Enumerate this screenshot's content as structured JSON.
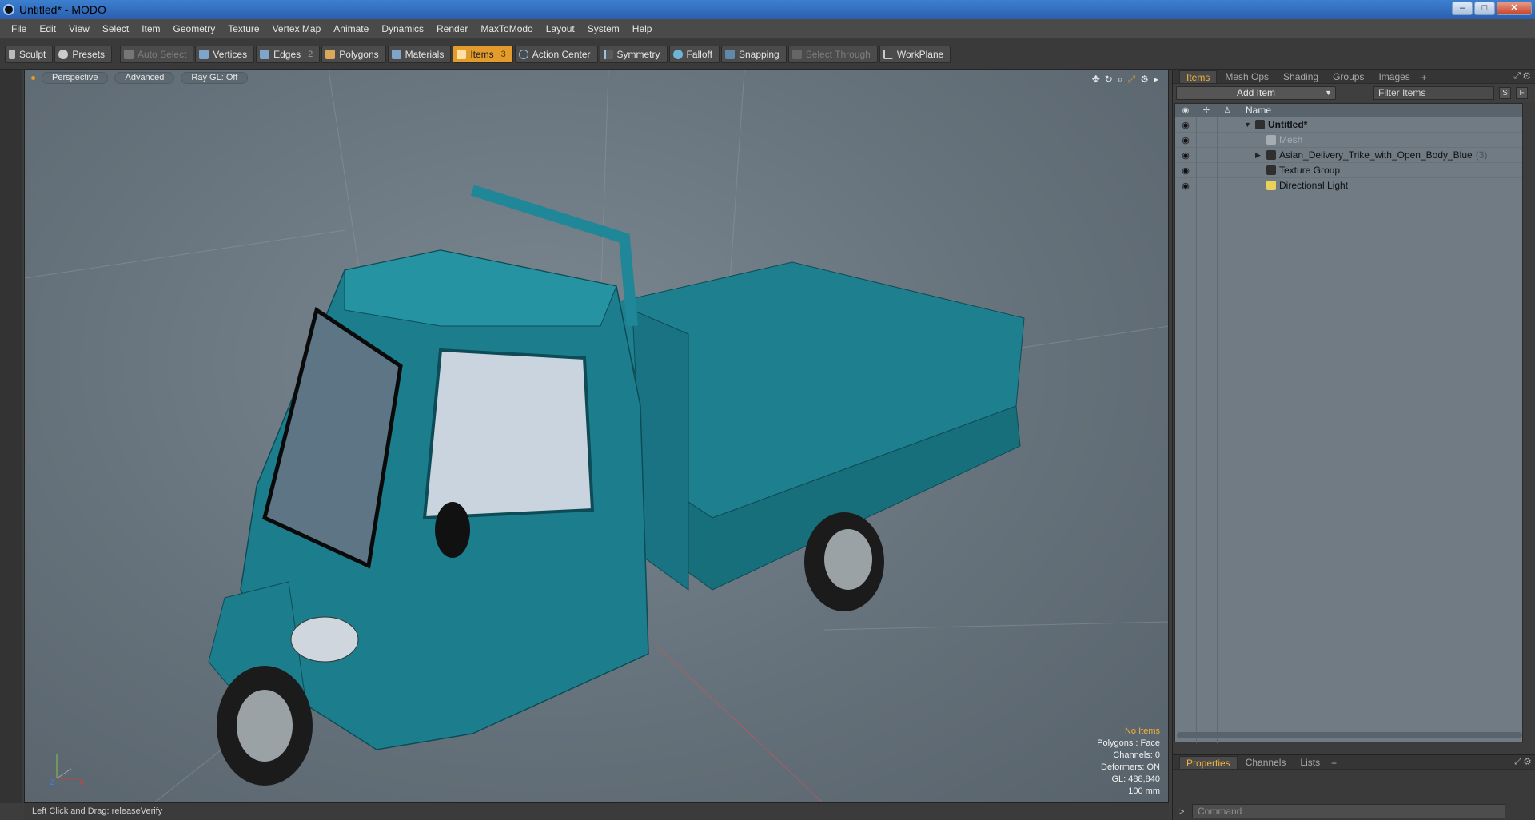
{
  "window": {
    "title": "Untitled* - MODO",
    "min": "–",
    "max": "□",
    "close": "✕"
  },
  "menu": [
    "File",
    "Edit",
    "View",
    "Select",
    "Item",
    "Geometry",
    "Texture",
    "Vertex Map",
    "Animate",
    "Dynamics",
    "Render",
    "MaxToModo",
    "Layout",
    "System",
    "Help"
  ],
  "toolbar": {
    "sculpt": "Sculpt",
    "presets": "Presets",
    "auto_select": "Auto Select",
    "vertices": "Vertices",
    "edges": "Edges",
    "edges_count": "2",
    "polygons": "Polygons",
    "materials": "Materials",
    "items": "Items",
    "items_count": "3",
    "action_center": "Action Center",
    "symmetry": "Symmetry",
    "falloff": "Falloff",
    "snapping": "Snapping",
    "select_through": "Select Through",
    "workplane": "WorkPlane"
  },
  "viewport": {
    "view": "Perspective",
    "style": "Advanced",
    "raygl": "Ray GL: Off",
    "info": {
      "selection": "No Items",
      "polygons": "Polygons : Face",
      "channels": "Channels: 0",
      "deformers": "Deformers: ON",
      "gl": "GL: 488,840",
      "scale": "100 mm"
    },
    "axis_x": "X",
    "axis_z": "Z"
  },
  "status": "Left Click and Drag:  releaseVerify",
  "panel": {
    "tabs": [
      "Items",
      "Mesh Ops",
      "Shading",
      "Groups",
      "Images"
    ],
    "add_item": "Add Item",
    "filter": "Filter Items",
    "btn_s": "S",
    "btn_f": "F",
    "column_name": "Name",
    "rows": [
      {
        "label": "Untitled*",
        "tri": "▼",
        "indent": 0
      },
      {
        "label": "Mesh",
        "tri": "",
        "indent": 1
      },
      {
        "label": "Asian_Delivery_Trike_with_Open_Body_Blue",
        "count": "(3)",
        "tri": "▶",
        "indent": 1
      },
      {
        "label": "Texture Group",
        "tri": "",
        "indent": 1
      },
      {
        "label": "Directional Light",
        "tri": "",
        "indent": 1
      }
    ],
    "bottom_tabs": [
      "Properties",
      "Channels",
      "Lists"
    ],
    "command_placeholder": "Command",
    "prompt": ">"
  }
}
